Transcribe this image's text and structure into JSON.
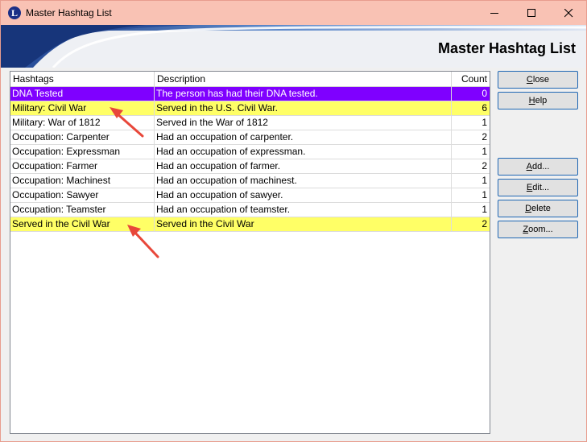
{
  "window": {
    "title": "Master Hashtag List",
    "app_icon_letter": "L",
    "controls": [
      "minimize",
      "maximize",
      "close"
    ]
  },
  "banner": {
    "title": "Master Hashtag List"
  },
  "table": {
    "columns": [
      "Hashtags",
      "Description",
      "Count"
    ],
    "rows": [
      {
        "hashtag": "DNA Tested",
        "description": "The person has had their DNA tested.",
        "count": "0",
        "highlight": "purple"
      },
      {
        "hashtag": "Military: Civil War",
        "description": "Served in the U.S. Civil War.",
        "count": "6",
        "highlight": "yellow"
      },
      {
        "hashtag": "Military: War of 1812",
        "description": "Served in the War of 1812",
        "count": "1",
        "highlight": "none"
      },
      {
        "hashtag": "Occupation: Carpenter",
        "description": "Had an occupation of carpenter.",
        "count": "2",
        "highlight": "none"
      },
      {
        "hashtag": "Occupation: Expressman",
        "description": "Had an occupation of expressman.",
        "count": "1",
        "highlight": "none"
      },
      {
        "hashtag": "Occupation: Farmer",
        "description": "Had an occupation of farmer.",
        "count": "2",
        "highlight": "none"
      },
      {
        "hashtag": "Occupation: Machinest",
        "description": "Had an occupation of machinest.",
        "count": "1",
        "highlight": "none"
      },
      {
        "hashtag": "Occupation: Sawyer",
        "description": "Had an occupation of sawyer.",
        "count": "1",
        "highlight": "none"
      },
      {
        "hashtag": "Occupation: Teamster",
        "description": "Had an occupation of teamster.",
        "count": "1",
        "highlight": "none"
      },
      {
        "hashtag": "Served in the Civil War",
        "description": "Served in the Civil War",
        "count": "2",
        "highlight": "yellow"
      }
    ]
  },
  "buttons": {
    "close": {
      "mnemonic": "C",
      "rest": "lose"
    },
    "help": {
      "mnemonic": "H",
      "rest": "elp"
    },
    "add": {
      "mnemonic": "A",
      "rest": "dd..."
    },
    "edit": {
      "mnemonic": "E",
      "rest": "dit..."
    },
    "delete": {
      "mnemonic": "D",
      "rest": "elete"
    },
    "zoom": {
      "mnemonic": "Z",
      "rest": "oom..."
    }
  },
  "colors": {
    "purple_highlight": "#7f00ff",
    "yellow_highlight": "#ffff66",
    "arrow": "#e8473a",
    "titlebar": "#f9c2b4"
  }
}
